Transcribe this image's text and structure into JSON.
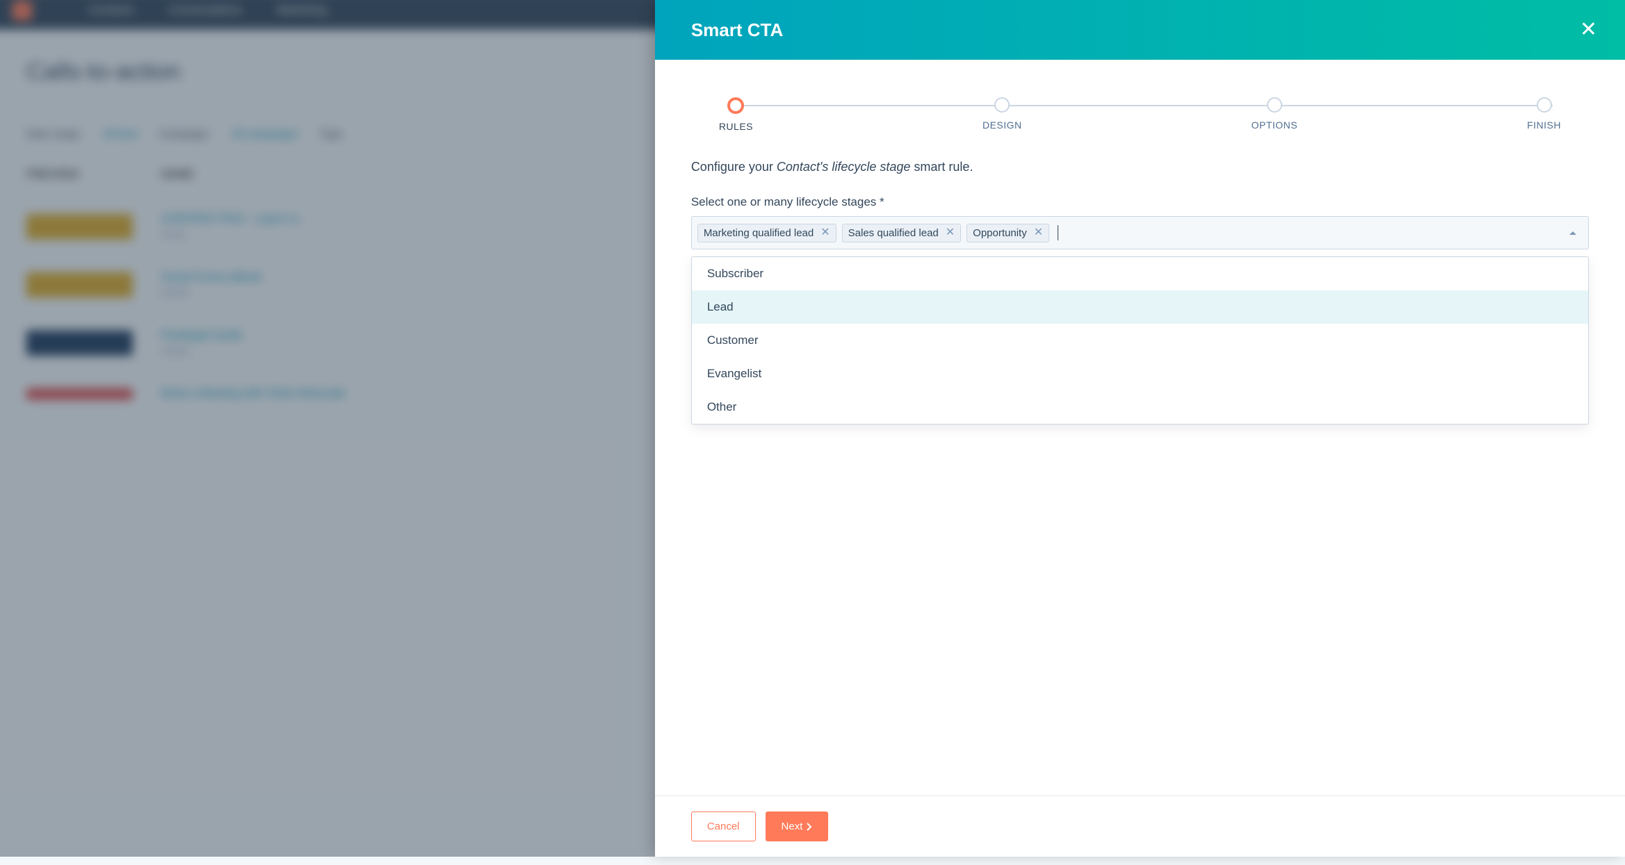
{
  "background": {
    "nav_items": [
      "Contacts",
      "Conversations",
      "Marketing"
    ],
    "page_title": "Calls-to-action",
    "filter_labels": [
      "Date range:",
      "Campaign:",
      "Type"
    ],
    "filter_values": [
      "All time",
      "All campaigns"
    ],
    "col_headers": [
      "PREVIEW",
      "NAME"
    ],
    "rows": [
      {
        "name": "CONTENT PICK - Learn m...",
        "sub": "Smart"
      },
      {
        "name": "Cloud Forms eBook",
        "sub": "Simple"
      },
      {
        "name": "Paralegal Guide",
        "sub": "Simple"
      },
      {
        "name": "Book a Meeting with Client Advocate",
        "sub": ""
      }
    ]
  },
  "panel": {
    "title": "Smart CTA",
    "steps": [
      "RULES",
      "DESIGN",
      "OPTIONS",
      "FINISH"
    ],
    "active_step_index": 0,
    "configure_prefix": "Configure your ",
    "configure_italic": "Contact's lifecycle stage",
    "configure_suffix": " smart rule.",
    "field_label": "Select one or many lifecycle stages *",
    "selected_tokens": [
      "Marketing qualified lead",
      "Sales qualified lead",
      "Opportunity"
    ],
    "dropdown_options": [
      "Subscriber",
      "Lead",
      "Customer",
      "Evangelist",
      "Other"
    ],
    "highlighted_option_index": 1,
    "footer": {
      "cancel": "Cancel",
      "next": "Next"
    }
  }
}
